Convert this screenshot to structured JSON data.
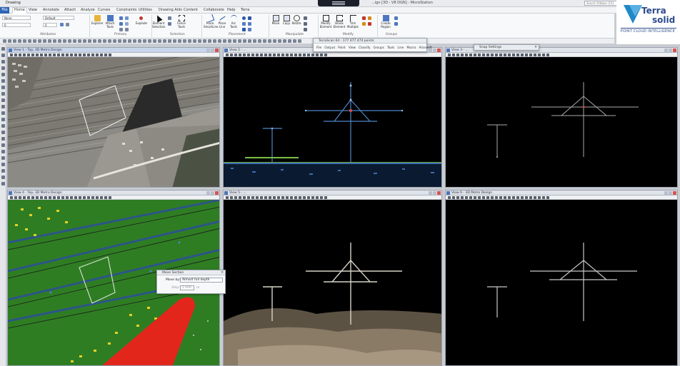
{
  "titlebar": {
    "app_name": "Drawing",
    "window_title": "...ign [3D - V8 DGN] - MicroStation",
    "search_placeholder": "Search Ribbon (F4)"
  },
  "ribbon_tabs": [
    "File",
    "Home",
    "View",
    "Annotate",
    "Attach",
    "Analyze",
    "Curves",
    "Constraints",
    "Utilities",
    "Drawing Aids",
    "Content",
    "Collaborate",
    "Help",
    "Terra"
  ],
  "active_tab": "Home",
  "ribbon": {
    "level_combo": "None",
    "style_combo": "Default",
    "weight_combo": "0",
    "color_combo": "0",
    "buttons": {
      "explorer": "Explorer",
      "attach_tools": "Attach Tools",
      "element_selection": "Element Selection",
      "fence_tools": "Fence Tools",
      "place_smartline": "Place SmartLine",
      "place_line": "Place Line",
      "arc_tools": "Arc Tools",
      "move": "Move",
      "copy": "Copy",
      "rotate": "Rotate",
      "modify_element": "Modify Element",
      "break_element": "Break Element",
      "trim_multiple": "Trim Multiple",
      "create_region": "Create Region",
      "explode": "Explode"
    },
    "groups": {
      "attributes": "Attributes",
      "primary": "Primary",
      "selection": "Selection",
      "placement": "Placement",
      "manipulate": "Manipulate",
      "modify": "Modify",
      "groups": "Groups"
    }
  },
  "logo": {
    "word1": "Terra",
    "word2": "solid",
    "tagline": "POINT CLOUD INTELLIGENCE"
  },
  "views": [
    {
      "id": "v1",
      "title": "View 1 - Top, 3D Metro Design",
      "active": true
    },
    {
      "id": "v2",
      "title": "View 2 - ...",
      "active": false
    },
    {
      "id": "v3",
      "title": "View 3 - ...",
      "active": false
    },
    {
      "id": "v4",
      "title": "View 4 - Top, 3D Metro Design",
      "active": false
    },
    {
      "id": "v5",
      "title": "View 5 - ...",
      "active": false
    },
    {
      "id": "v6",
      "title": "View 6 - 3D Metro Design",
      "active": false
    }
  ],
  "terrascan_window": {
    "title": "TerraScan 64 - 177 477 474 points",
    "menu": [
      "File",
      "Output",
      "Point",
      "View",
      "Classify",
      "Groups",
      "Tools",
      "Line",
      "Macro",
      "Alicesoft"
    ]
  },
  "snap_settings": {
    "title": "Snap Settings"
  },
  "move_section": {
    "title": "Move Section",
    "move_by_label": "Move by:",
    "move_by_value": "Almost full depth",
    "step_label": "Step:",
    "step_value": "1.000",
    "step_unit": "m"
  },
  "colors": {
    "ribbon_file_tab": "#2d66b4",
    "brand": "#2b4a8c",
    "view_bg": "#000000",
    "class_ground_green": "#2f7d23",
    "class_highlight_red": "#e3261c"
  }
}
